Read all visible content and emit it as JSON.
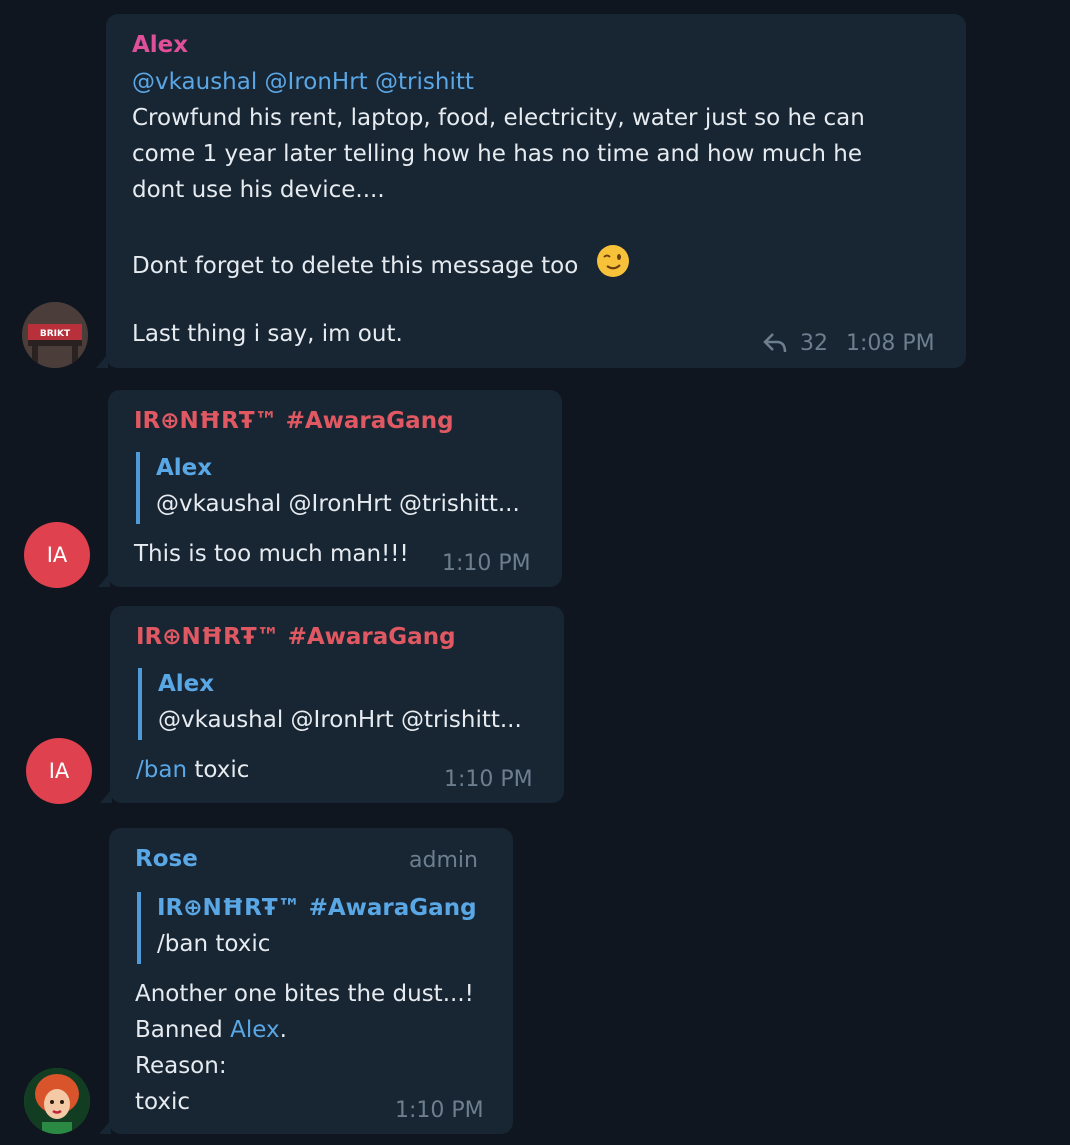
{
  "messages": [
    {
      "sender": "Alex",
      "sender_color": "#e0509a",
      "mentions": "@vkaushal @IronHrt @trishitt",
      "lines": [
        "Crowfund his rent, laptop, food, electricity, water just so he can",
        "come 1 year later telling how he has no time and how much he",
        "dont use his device....",
        "Dont forget to delete this message too",
        "Last thing i say, im out."
      ],
      "emoji": "wink",
      "reply_count": "32",
      "time": "1:08 PM",
      "avatar_label": "BRIKT"
    },
    {
      "sender": "IR⊕NĦRŦ™ #AwaraGang",
      "sender_color": "#e05962",
      "quote_name": "Alex",
      "quote_text": "@vkaushal @IronHrt @trishitt...",
      "text": "This is too much man!!!",
      "time": "1:10 PM",
      "avatar_initials": "IA",
      "avatar_color": "#e0414f"
    },
    {
      "sender": "IR⊕NĦRŦ™ #AwaraGang",
      "sender_color": "#e05962",
      "quote_name": "Alex",
      "quote_text": "@vkaushal @IronHrt @trishitt...",
      "command": "/ban",
      "text": "toxic",
      "time": "1:10 PM",
      "avatar_initials": "IA",
      "avatar_color": "#e0414f"
    },
    {
      "sender": "Rose",
      "sender_color": "#5aa7e6",
      "badge": "admin",
      "quote_name": "IR⊕NĦRŦ™ #AwaraGang",
      "quote_text": "/ban toxic",
      "line1": "Another one bites the dust...!",
      "banned_prefix": "Banned",
      "banned_user": "Alex",
      "banned_suffix": ".",
      "line3": "Reason:",
      "line4": "toxic",
      "time": "1:10 PM"
    }
  ]
}
